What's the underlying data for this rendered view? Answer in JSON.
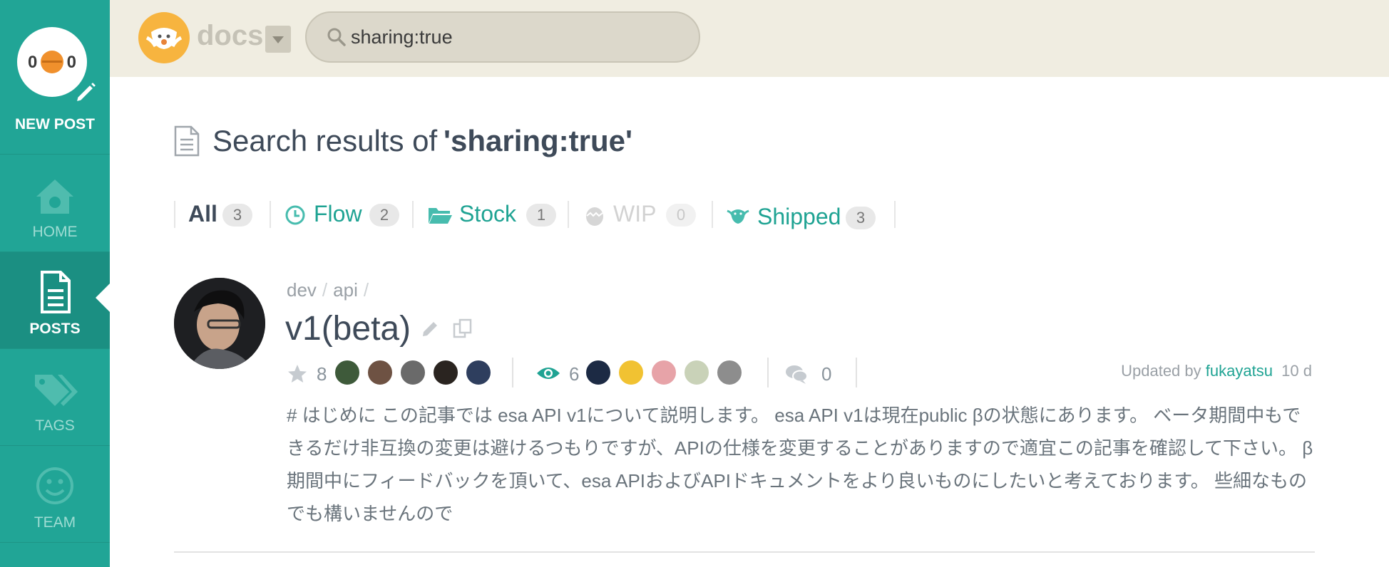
{
  "sidebar": {
    "new_post_label": "NEW POST",
    "items": [
      {
        "label": "HOME",
        "icon": "home-icon"
      },
      {
        "label": "POSTS",
        "icon": "document-icon",
        "active": true
      },
      {
        "label": "TAGS",
        "icon": "tags-icon"
      },
      {
        "label": "TEAM",
        "icon": "smile-icon"
      }
    ]
  },
  "topbar": {
    "team_name": "docs",
    "search": {
      "value": "sharing:true"
    }
  },
  "main": {
    "heading_prefix": "Search results of",
    "heading_query": "'sharing:true'",
    "tabs": [
      {
        "label": "All",
        "count": "3"
      },
      {
        "label": "Flow",
        "count": "2",
        "icon": "clock-icon"
      },
      {
        "label": "Stock",
        "count": "1",
        "icon": "folder-icon"
      },
      {
        "label": "WIP",
        "count": "0",
        "icon": "egg-icon"
      },
      {
        "label": "Shipped",
        "count": "3",
        "icon": "bird-icon"
      }
    ]
  },
  "post": {
    "path": [
      "dev",
      "api"
    ],
    "title": "v1(beta)",
    "stars": "8",
    "watchers": "6",
    "comments": "0",
    "updated_prefix": "Updated by",
    "updated_author": "fukayatsu",
    "updated_ago": "10 d",
    "excerpt": "# はじめに この記事では esa API v1について説明します。 esa API v1は現在public βの状態にあります。 ベータ期間中もできるだけ非互換の変更は避けるつもりですが、APIの仕様を変更することがありますので適宜この記事を確認して下さい。 β期間中にフィードバックを頂いて、esa APIおよびAPIドキュメントをより良いものにしたいと考えております。 些細なものでも構いませんので"
  },
  "colors": {
    "sidebar": "#21a596",
    "sidebar_active": "#1b8f82",
    "topbar": "#f0ede1",
    "accent": "#1fa393",
    "logo": "#f7b43f"
  }
}
